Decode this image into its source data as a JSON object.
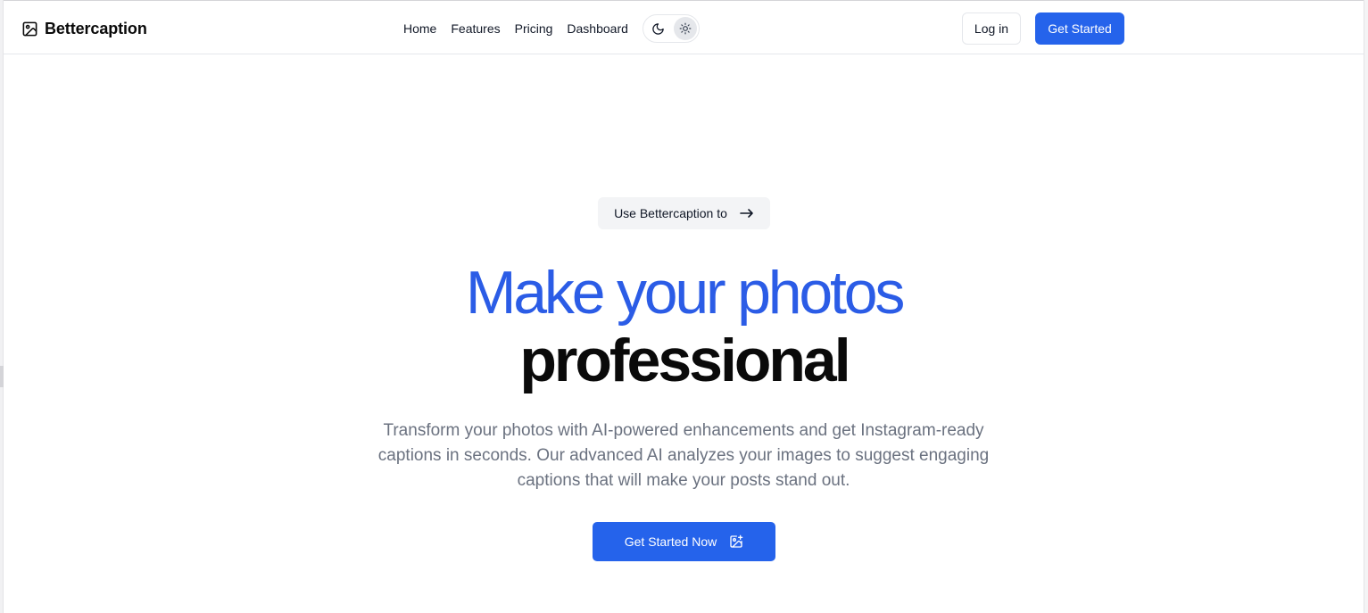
{
  "brand": {
    "name": "Bettercaption",
    "icon": "image-icon"
  },
  "nav": {
    "items": [
      {
        "label": "Home"
      },
      {
        "label": "Features"
      },
      {
        "label": "Pricing"
      },
      {
        "label": "Dashboard"
      }
    ],
    "theme_toggle": {
      "options": [
        "moon-icon",
        "sun-icon"
      ],
      "selected": "sun-icon"
    }
  },
  "header_actions": {
    "login_label": "Log in",
    "get_started_label": "Get Started"
  },
  "hero": {
    "pill_label": "Use Bettercaption to",
    "pill_icon": "arrow-right-icon",
    "headline_line1": "Make your photos",
    "headline_line2": "professional",
    "description": "Transform your photos with AI-powered enhancements and get Instagram-ready captions in seconds. Our advanced AI analyzes your images to suggest engaging captions that will make your posts stand out.",
    "cta_label": "Get Started Now",
    "cta_icon": "image-plus-icon"
  },
  "colors": {
    "accent": "#2563eb",
    "headline_blue": "#2b5ce6",
    "text_muted": "#6b7280"
  }
}
